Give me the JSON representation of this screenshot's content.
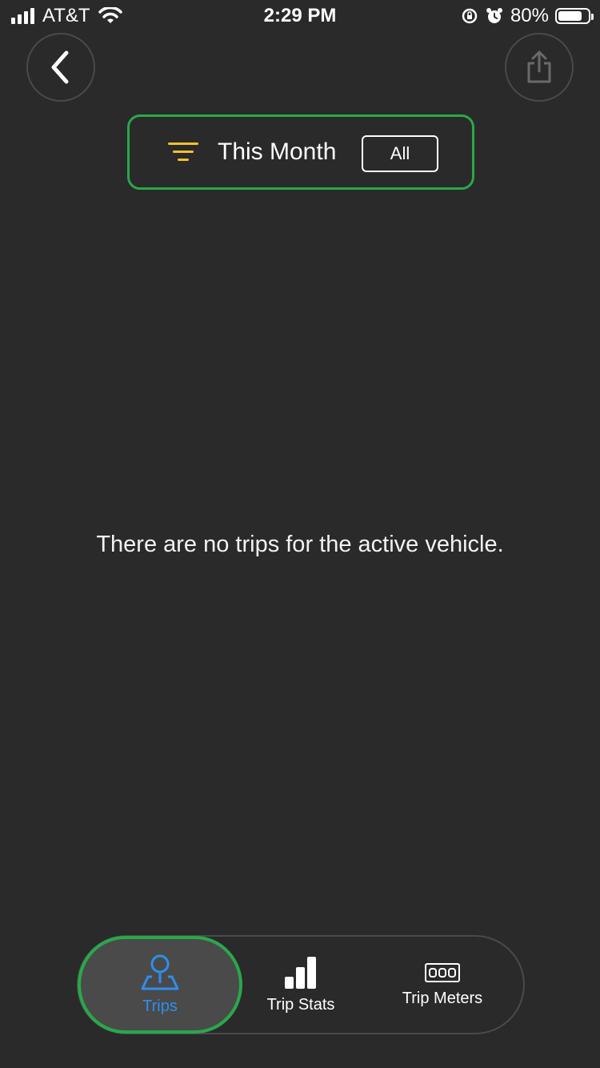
{
  "status_bar": {
    "carrier": "AT&T",
    "time": "2:29 PM",
    "battery_percent": "80%",
    "battery_level": 0.8,
    "icons": [
      "signal-icon",
      "wifi-icon",
      "orientation-lock-icon",
      "alarm-icon",
      "battery-icon"
    ]
  },
  "header": {
    "back_icon": "chevron-left-icon",
    "share_icon": "share-icon"
  },
  "filter": {
    "icon": "filter-icon",
    "period_label": "This Month",
    "all_label": "All",
    "accent_color": "#f5c02c"
  },
  "main": {
    "empty_message": "There are no trips for the active vehicle."
  },
  "tab_bar": {
    "tabs": [
      {
        "label": "Trips",
        "icon": "trip-pin-icon",
        "active": true
      },
      {
        "label": "Trip Stats",
        "icon": "bar-chart-icon",
        "active": false
      },
      {
        "label": "Trip Meters",
        "icon": "odometer-icon",
        "active": false
      }
    ],
    "active_color": "#2e8ef0",
    "highlight_color": "#29a84a"
  }
}
